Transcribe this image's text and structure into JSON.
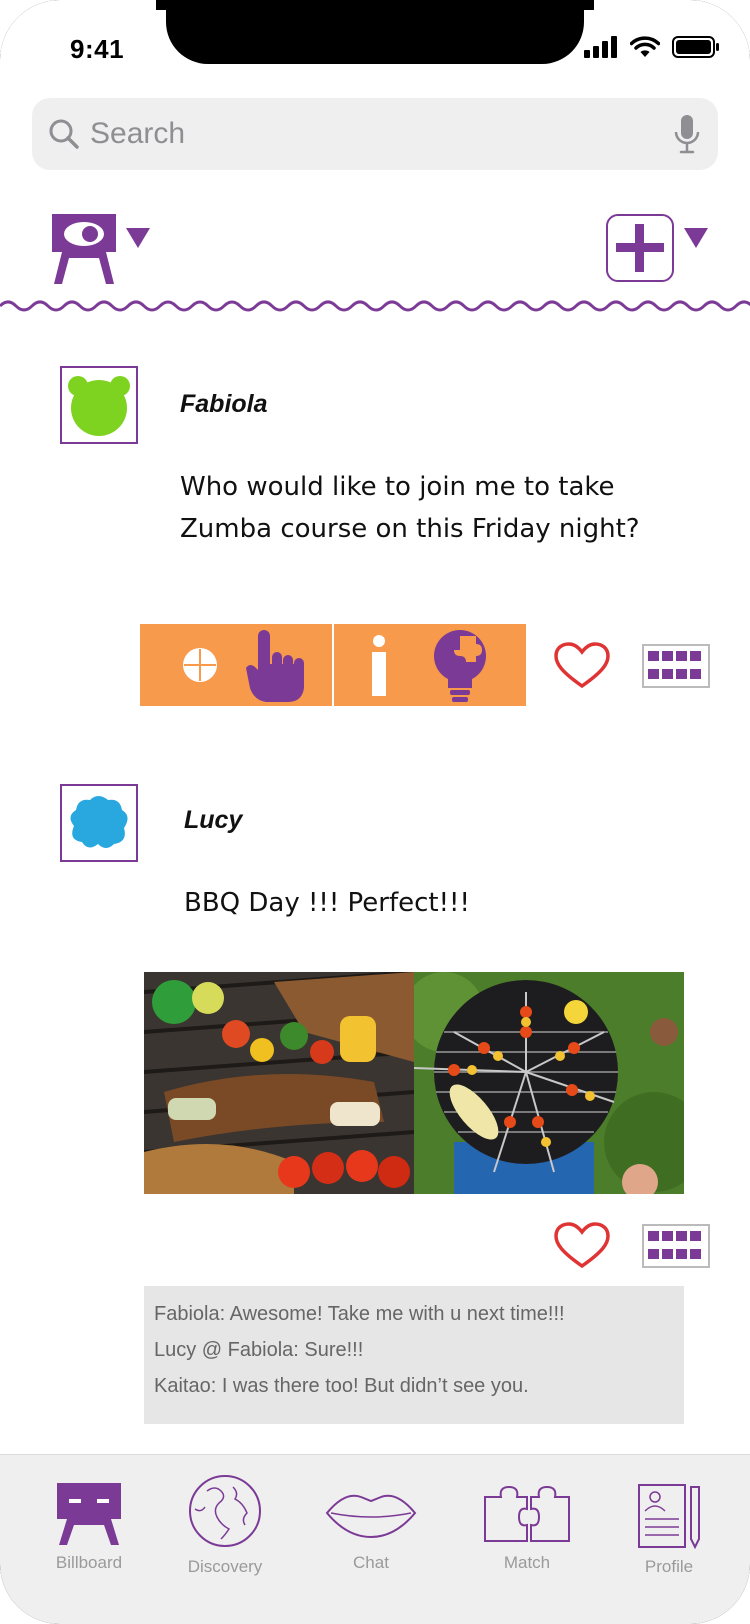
{
  "status_bar": {
    "time": "9:41"
  },
  "search": {
    "placeholder": "Search"
  },
  "icons": {
    "search": "search-icon",
    "mic": "microphone-icon",
    "billboard": "billboard-icon",
    "add": "plus-icon",
    "like": "heart-icon",
    "more": "grid-icon"
  },
  "colors": {
    "accent": "#7b3a95",
    "action_strip": "#f79a4b",
    "like": "#e03434"
  },
  "posts": [
    {
      "author": "Fabiola",
      "avatar": "green-bear-avatar",
      "text_lines": [
        "Who would like to join me to take",
        "Zumba course on this Friday night?"
      ]
    },
    {
      "author": "Lucy",
      "avatar": "blue-blob-avatar",
      "text_lines": [
        "BBQ Day !!! Perfect!!!"
      ],
      "comments": [
        "Fabiola: Awesome! Take me with u next time!!!",
        "Lucy @ Fabiola: Sure!!!",
        "Kaitao: I was there too! But didn’t see you."
      ]
    }
  ],
  "tabs": [
    {
      "label": "Billboard",
      "icon": "billboard-icon",
      "active": true
    },
    {
      "label": "Discovery",
      "icon": "globe-icon",
      "active": false
    },
    {
      "label": "Chat",
      "icon": "lips-icon",
      "active": false
    },
    {
      "label": "Match",
      "icon": "puzzle-icon",
      "active": false
    },
    {
      "label": "Profile",
      "icon": "profile-document-icon",
      "active": false
    }
  ]
}
